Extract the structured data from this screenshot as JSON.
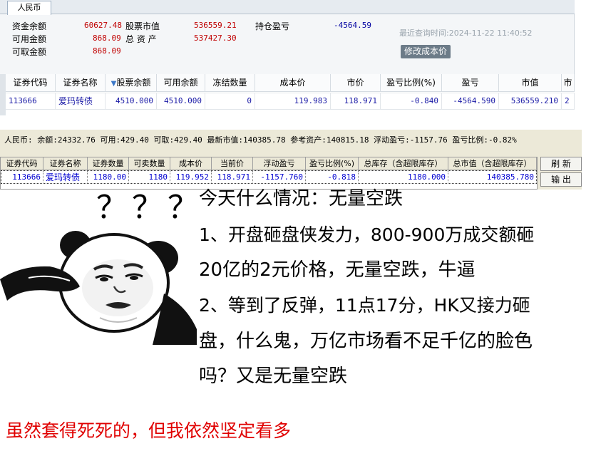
{
  "panel1": {
    "tab_label": "人民币",
    "rows": [
      {
        "label": "资金余额",
        "value": "60627.48",
        "label2": "股票市值",
        "value2": "536559.21",
        "label3": "持仓盈亏",
        "value3": "-4564.59"
      },
      {
        "label": "可用金额",
        "value": "868.09",
        "label2": "总 资 产",
        "value2": "537427.30"
      },
      {
        "label": "可取金额",
        "value": "868.09"
      }
    ],
    "last_query": "最近查询时间:2024-11-22 11:40:52",
    "modify_cost_button": "修改成本价",
    "table": {
      "headers": [
        "证券代码",
        "证券名称",
        "股票余额",
        "可用余额",
        "冻结数量",
        "成本价",
        "市价",
        "盈亏比例(%)",
        "盈亏",
        "市值",
        "市"
      ],
      "sort_indicator": "▼",
      "rows": [
        [
          "113666",
          "爱玛转债",
          "4510.000",
          "4510.000",
          "0",
          "119.983",
          "118.971",
          "-0.840",
          "-4564.590",
          "536559.210",
          "2"
        ]
      ]
    }
  },
  "panel2": {
    "summary": "人民币: 余额:24332.76  可用:429.40  可取:429.40  最新市值:140385.78  参考资产:140815.18  浮动盈亏:-1157.76  盈亏比例:-0.82%",
    "table": {
      "headers": [
        "证券代码",
        "证券名称",
        "证券数量",
        "可卖数量",
        "成本价",
        "当前价",
        "浮动盈亏",
        "盈亏比例(%)",
        "总库存（含超限库存）",
        "总市值（含超限库存）"
      ],
      "rows": [
        [
          "113666",
          "爱玛转债",
          "1180.00",
          "1180",
          "119.952",
          "118.971",
          "-1157.760",
          "-0.818",
          "1180.000",
          "140385.780"
        ]
      ]
    },
    "buttons": [
      "刷 新",
      "输 出"
    ]
  },
  "meme": {
    "question_marks": [
      "？",
      "？",
      "？"
    ]
  },
  "post": {
    "lines": [
      "今天什么情况：无量空跌",
      "1、开盘砸盘侠发力，800-900万成交额砸",
      "20亿的2元价格，无量空跌，牛逼",
      "2、等到了反弹，11点17分，HK又接力砸",
      "盘，什么鬼，万亿市场看不足千亿的脸色",
      "吗？又是无量空跌"
    ],
    "red_line": "虽然套得死死的，但我依然坚定看多"
  },
  "colors": {
    "red_value": "#c00000",
    "blue_value": "#0000d0",
    "red_text": "#e00000"
  }
}
